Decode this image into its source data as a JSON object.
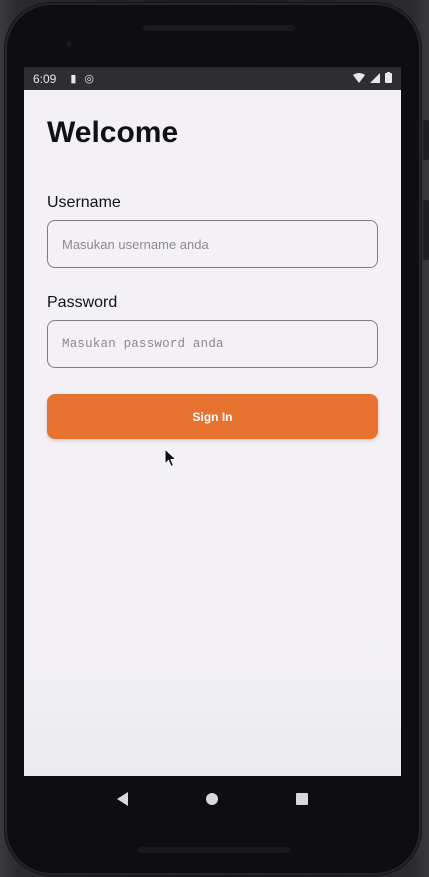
{
  "status_bar": {
    "time": "6:09",
    "icons_left": [
      "sim-card-icon",
      "data-saver-icon"
    ],
    "icons_right": [
      "wifi-icon",
      "signal-icon",
      "battery-icon"
    ]
  },
  "screen": {
    "title": "Welcome",
    "username": {
      "label": "Username",
      "placeholder": "Masukan username anda",
      "value": ""
    },
    "password": {
      "label": "Password",
      "placeholder": "Masukan password anda",
      "value": ""
    },
    "signin_label": "Sign In"
  },
  "colors": {
    "accent": "#e87230",
    "background": "#f3f1f6",
    "field_border": "#807d86"
  },
  "nav": {
    "items": [
      "back-icon",
      "home-icon",
      "recents-icon"
    ]
  }
}
